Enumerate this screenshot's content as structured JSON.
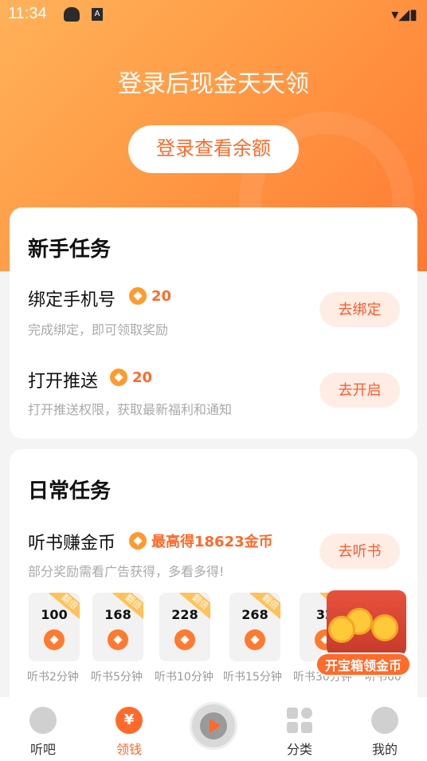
{
  "status_bar": {
    "time": "11:34",
    "badge_a": "A"
  },
  "hero": {
    "title": "登录后现金天天领",
    "login_button": "登录查看余额"
  },
  "newbie": {
    "title": "新手任务",
    "tasks": [
      {
        "name": "绑定手机号",
        "reward": "20",
        "desc": "完成绑定，即可领取奖励",
        "button": "去绑定"
      },
      {
        "name": "打开推送",
        "reward": "20",
        "desc": "打开推送权限，获取最新福利和通知",
        "button": "去开启"
      }
    ]
  },
  "daily": {
    "title": "日常任务",
    "task": {
      "name": "听书赚金币",
      "reward": "最高得18623金币",
      "desc": "部分奖励需看广告获得，多看多得!",
      "button": "去听书"
    },
    "tiles": [
      {
        "amount": "100",
        "badge": "翻倍",
        "label": "听书2分钟"
      },
      {
        "amount": "168",
        "badge": "翻倍",
        "label": "听书5分钟"
      },
      {
        "amount": "228",
        "badge": "翻倍",
        "label": "听书10分钟"
      },
      {
        "amount": "268",
        "badge": "翻倍",
        "label": "听书15分钟"
      },
      {
        "amount": "32",
        "badge": "翻倍",
        "label": "听书30分钟"
      }
    ],
    "partial_label": "听书60"
  },
  "treasure": {
    "label": "开宝箱领金币"
  },
  "tabbar": {
    "items": [
      {
        "label": "听吧"
      },
      {
        "label": "领钱",
        "icon_text": "¥"
      },
      {
        "label": "分类"
      },
      {
        "label": "我的"
      }
    ]
  },
  "colors": {
    "accent": "#ff6a2b",
    "hero_start": "#ffb25a",
    "hero_end": "#ff7a33"
  }
}
